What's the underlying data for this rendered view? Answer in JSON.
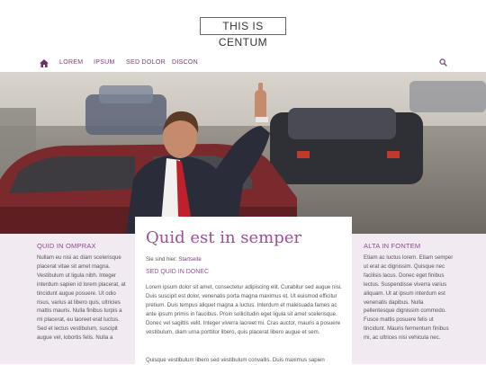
{
  "header": {
    "logo_text": "THIS IS CENTUM"
  },
  "nav": {
    "items": [
      "LOREM",
      "IPSUM",
      "SED DOLOR",
      "DISCON"
    ]
  },
  "left": {
    "title": "QUID IN OMPRAX",
    "text": "Nullam eu nisi ac diam scelerisque placerat vitae sit amet magna. Vestibulum ut ligula nibh. Integer interdum sapien id lorem placerat, at tincidunt augue posuere. Ut odio risus, varius at libero quis, ultricies mattis mauris. Nulla finibus turpis a mi placerat, eu laoreet erat luctus. Sed et lectus vestibulum, suscipit augue vel, lobortis felis. Nulla a"
  },
  "main": {
    "title": "Quid est in semper",
    "breadcrumb_prefix": "Sie sind hier: ",
    "breadcrumb_link": "Startseite",
    "section_title": "SED QUID IN DONEC",
    "paragraph1": "Lorem ipsum dolor sit amet, consectetur adipiscing elit. Curabitur sed augue nisi. Duis suscipit est dolor, venenatis porta magna maximus et. Ut euismod efficitur pretium. Duis tempus aliquet magna a luctus. Interdum et malesuada fames ac ante ipsum primis in faucibus. Proin sollicitudin eget ligula sit amet scelerisque. Donec vel sagittis velit. Integer viverra laoreet mi. Cras auctor, mauris a posuere vestibulum, diam urna porttitor libero, quis placerat libero augue et sem.",
    "paragraph2": "Quisque vestibulum libero sed vestibulum convallis. Duis maximus sapien"
  },
  "right": {
    "title": "ALTA IN FONTEM",
    "text": "Etiam ac luctus lorem. Etiam semper ut erat ac dignissim. Quisque nec facilisis lacus. Donec eget finibus lectus. Suspendisse viverra varius aliquam. Ut at ipsum interdum est venenatis dapibus. Nulla pellentesque dignissim commodo. Fusce mattis posuere felis ut tincidunt. Mauris fermentum finibus mi, ac ultrices nisi vehicula nec."
  },
  "colors": {
    "accent": "#9a4f9a",
    "nav": "#7a3b7a",
    "side_bg": "#f1eaf1"
  },
  "icons": {
    "home": "home-icon",
    "search": "search-icon"
  }
}
